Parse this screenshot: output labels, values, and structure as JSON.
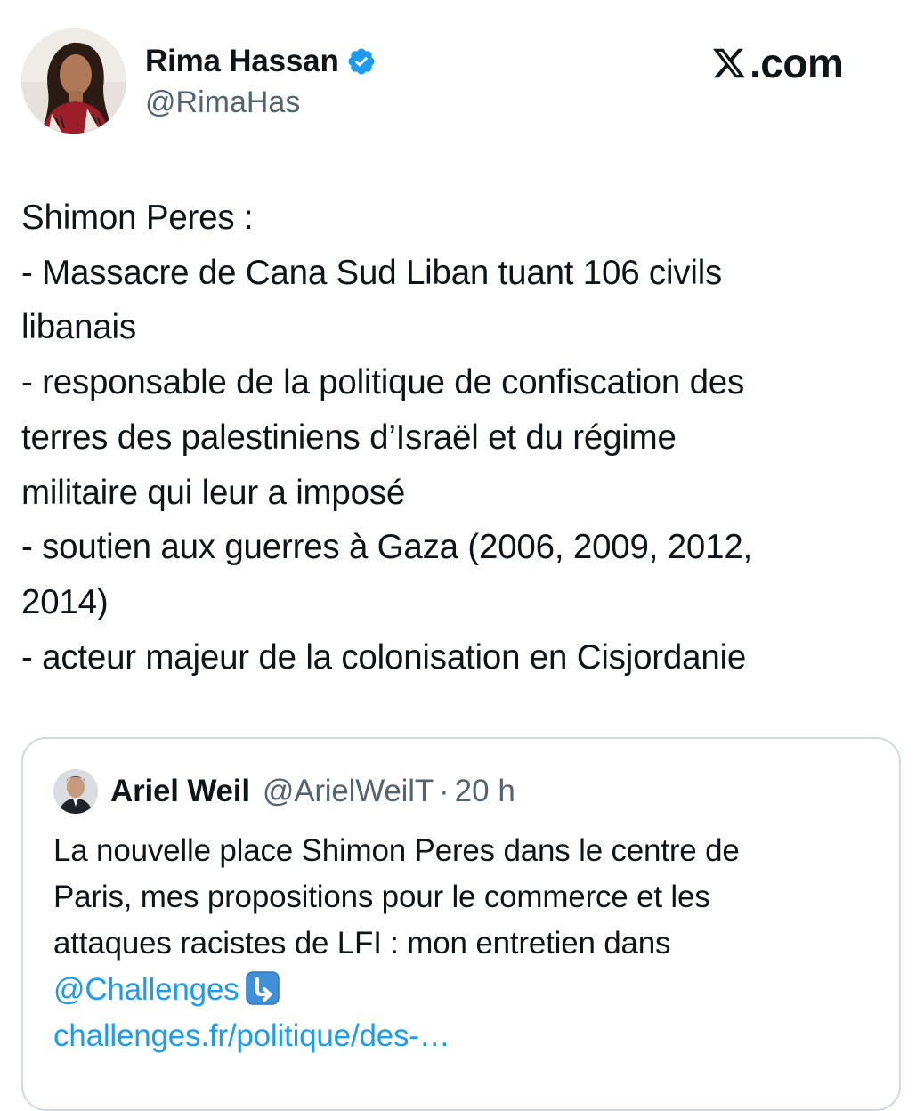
{
  "author": {
    "name": "Rima Hassan",
    "handle": "@RimaHas",
    "verified_icon": "verified-badge-icon",
    "verified_color": "#1d9bf0"
  },
  "site": {
    "logo_text": ".com",
    "logo_icon": "x-logo-icon"
  },
  "tweet": {
    "lines": [
      "Shimon Peres :",
      "- Massacre de Cana Sud Liban tuant 106 civils",
      "libanais",
      "- responsable de la politique de confiscation des",
      "terres des palestiniens d’Israël et du régime",
      "militaire qui leur a imposé",
      "- soutien aux guerres à Gaza (2006, 2009, 2012,",
      "2014)",
      "- acteur majeur de la colonisation en Cisjordanie"
    ]
  },
  "quote": {
    "name": "Ariel Weil",
    "handle": "@ArielWeilT",
    "separator": "·",
    "time": "20 h",
    "lines": [
      "La nouvelle place Shimon Peres dans le centre de",
      "Paris, mes propositions pour le commerce et les",
      "attaques racistes de LFI : mon entretien dans"
    ],
    "mention": "@Challenges",
    "emoji_icon": "arrow-down-right-emoji-icon",
    "link": "challenges.fr/politique/des-…"
  },
  "colors": {
    "text": "#0f1419",
    "secondary": "#536471",
    "link": "#1d9bf0",
    "border": "#cfd9de"
  }
}
